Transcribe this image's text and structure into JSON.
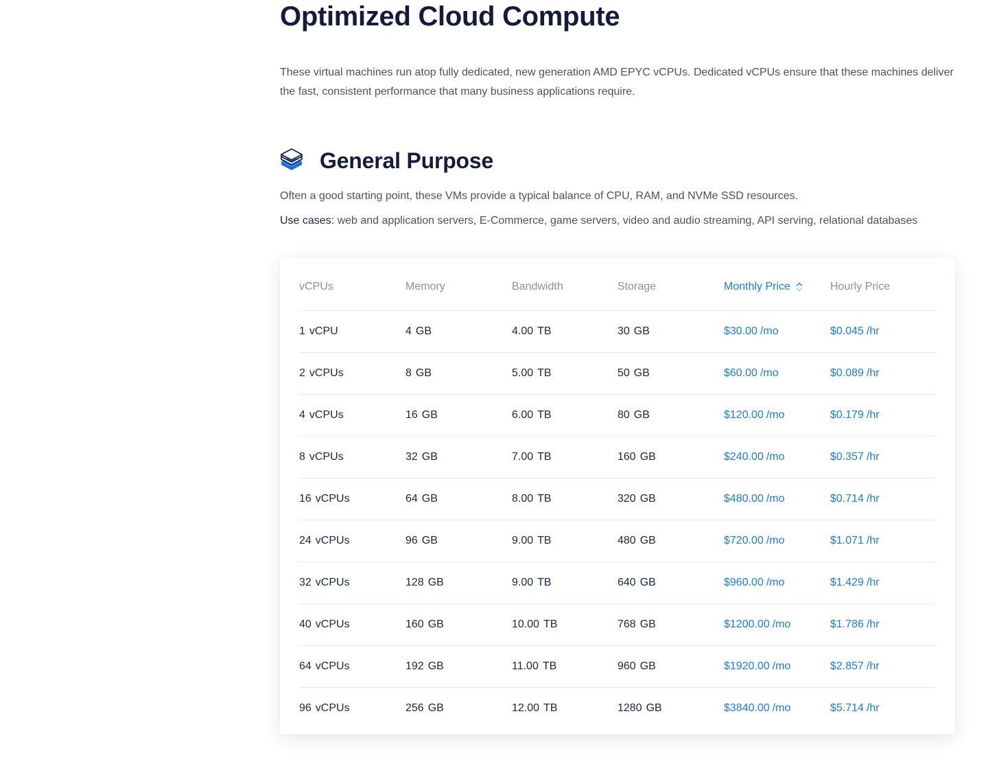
{
  "page": {
    "title": "Optimized Cloud Compute",
    "intro": "These virtual machines run atop fully dedicated, new generation AMD EPYC vCPUs. Dedicated vCPUs ensure that these machines deliver the fast, consistent performance that many business applications require."
  },
  "section": {
    "icon": "stacked-layers-icon",
    "title": "General Purpose",
    "description": "Often a good starting point, these VMs provide a typical balance of CPU, RAM, and NVMe SSD resources.",
    "use_cases_label": "Use cases:",
    "use_cases_text": " web and application servers, E-Commerce, game servers, video and audio streaming, API serving, relational databases"
  },
  "table": {
    "headers": [
      "vCPUs",
      "Memory",
      "Bandwidth",
      "Storage",
      "Monthly Price",
      "Hourly Price"
    ],
    "sorted_column": "Monthly Price",
    "rows": [
      {
        "vcpu_num": "1",
        "vcpu_unit": "vCPU",
        "mem_num": "4",
        "mem_unit": "GB",
        "bw_num": "4.00",
        "bw_unit": "TB",
        "st_num": "30",
        "st_unit": "GB",
        "monthly": "$30.00",
        "monthly_unit": "/mo",
        "hourly": "$0.045",
        "hourly_unit": "/hr"
      },
      {
        "vcpu_num": "2",
        "vcpu_unit": "vCPUs",
        "mem_num": "8",
        "mem_unit": "GB",
        "bw_num": "5.00",
        "bw_unit": "TB",
        "st_num": "50",
        "st_unit": "GB",
        "monthly": "$60.00",
        "monthly_unit": "/mo",
        "hourly": "$0.089",
        "hourly_unit": "/hr"
      },
      {
        "vcpu_num": "4",
        "vcpu_unit": "vCPUs",
        "mem_num": "16",
        "mem_unit": "GB",
        "bw_num": "6.00",
        "bw_unit": "TB",
        "st_num": "80",
        "st_unit": "GB",
        "monthly": "$120.00",
        "monthly_unit": "/mo",
        "hourly": "$0.179",
        "hourly_unit": "/hr"
      },
      {
        "vcpu_num": "8",
        "vcpu_unit": "vCPUs",
        "mem_num": "32",
        "mem_unit": "GB",
        "bw_num": "7.00",
        "bw_unit": "TB",
        "st_num": "160",
        "st_unit": "GB",
        "monthly": "$240.00",
        "monthly_unit": "/mo",
        "hourly": "$0.357",
        "hourly_unit": "/hr"
      },
      {
        "vcpu_num": "16",
        "vcpu_unit": "vCPUs",
        "mem_num": "64",
        "mem_unit": "GB",
        "bw_num": "8.00",
        "bw_unit": "TB",
        "st_num": "320",
        "st_unit": "GB",
        "monthly": "$480.00",
        "monthly_unit": "/mo",
        "hourly": "$0.714",
        "hourly_unit": "/hr"
      },
      {
        "vcpu_num": "24",
        "vcpu_unit": "vCPUs",
        "mem_num": "96",
        "mem_unit": "GB",
        "bw_num": "9.00",
        "bw_unit": "TB",
        "st_num": "480",
        "st_unit": "GB",
        "monthly": "$720.00",
        "monthly_unit": "/mo",
        "hourly": "$1.071",
        "hourly_unit": "/hr"
      },
      {
        "vcpu_num": "32",
        "vcpu_unit": "vCPUs",
        "mem_num": "128",
        "mem_unit": "GB",
        "bw_num": "9.00",
        "bw_unit": "TB",
        "st_num": "640",
        "st_unit": "GB",
        "monthly": "$960.00",
        "monthly_unit": "/mo",
        "hourly": "$1.429",
        "hourly_unit": "/hr"
      },
      {
        "vcpu_num": "40",
        "vcpu_unit": "vCPUs",
        "mem_num": "160",
        "mem_unit": "GB",
        "bw_num": "10.00",
        "bw_unit": "TB",
        "st_num": "768",
        "st_unit": "GB",
        "monthly": "$1200.00",
        "monthly_unit": "/mo",
        "hourly": "$1.786",
        "hourly_unit": "/hr"
      },
      {
        "vcpu_num": "64",
        "vcpu_unit": "vCPUs",
        "mem_num": "192",
        "mem_unit": "GB",
        "bw_num": "11.00",
        "bw_unit": "TB",
        "st_num": "960",
        "st_unit": "GB",
        "monthly": "$1920.00",
        "monthly_unit": "/mo",
        "hourly": "$2.857",
        "hourly_unit": "/hr"
      },
      {
        "vcpu_num": "96",
        "vcpu_unit": "vCPUs",
        "mem_num": "256",
        "mem_unit": "GB",
        "bw_num": "12.00",
        "bw_unit": "TB",
        "st_num": "1280",
        "st_unit": "GB",
        "monthly": "$3840.00",
        "monthly_unit": "/mo",
        "hourly": "$5.714",
        "hourly_unit": "/hr"
      }
    ]
  },
  "colors": {
    "heading": "#141b3d",
    "body_text": "#4b5165",
    "accent": "#1b7ce0",
    "header_muted": "#8a90a3",
    "divider": "#e6e8ee"
  }
}
